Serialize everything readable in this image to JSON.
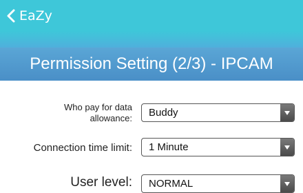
{
  "nav": {
    "back_label": "EaZy"
  },
  "header": {
    "title": "Permission Setting (2/3) - IPCAM"
  },
  "form": {
    "data_allowance": {
      "label_line1": "Who pay for data",
      "label_line2": "allowance:",
      "value": "Buddy"
    },
    "connection_time_limit": {
      "label": "Connection time limit:",
      "value": "1 Minute"
    },
    "user_level": {
      "label": "User level:",
      "value": "NORMAL"
    }
  },
  "icons": {
    "back": "chevron-left-icon",
    "dropdown": "caret-down-icon"
  },
  "colors": {
    "nav_bg": "#3ec7d9",
    "title_bg": "#4a8fc7",
    "text": "#222222"
  }
}
